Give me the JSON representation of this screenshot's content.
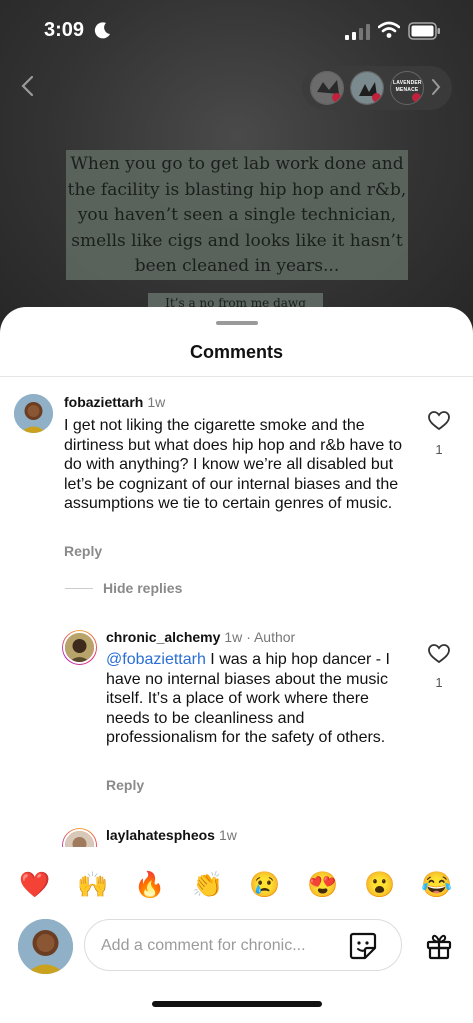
{
  "status_bar": {
    "time": "3:09"
  },
  "story_avatars": [
    {
      "label": ""
    },
    {
      "label": ""
    },
    {
      "label": "LAVENDER MENACE"
    }
  ],
  "post": {
    "text": "When you go to get lab work done and the facility is blasting hip hop and r&b, you haven’t seen a single technician, smells like cigs and looks like it hasn’t been cleaned in years...",
    "text_partial": "It’s a no from me dawg"
  },
  "sheet": {
    "title": "Comments"
  },
  "comments": [
    {
      "user": "fobaziettarh",
      "time": "1w",
      "body": "I get not liking the cigarette smoke and the dirtiness but what does hip hop and r&b have to do with anything? I know we’re all disabled but let’s be cognizant of our internal biases and the assumptions we tie to certain genres of music.",
      "reply_label": "Reply",
      "like_count": "1",
      "hide_replies_label": "Hide replies"
    },
    {
      "user": "chronic_alchemy",
      "time": "1w",
      "author_tag": "· Author",
      "mention": "@fobaziettarh",
      "body": " I was a hip hop dancer - I have no internal biases about the music itself. It’s a place of work where there needs to be cleanliness and professionalism for the safety of others.",
      "reply_label": "Reply",
      "like_count": "1"
    },
    {
      "user": "laylahatespheos",
      "time": "1w"
    }
  ],
  "emoji_bar": [
    "❤️",
    "🙌",
    "🔥",
    "👏",
    "😢",
    "😍",
    "😮",
    "😂"
  ],
  "input": {
    "placeholder": "Add a comment for chronic..."
  },
  "colors": {
    "mention": "#2a6fd6",
    "accent_ring": "#e8306b",
    "emoji_heart": "#e0162b"
  }
}
